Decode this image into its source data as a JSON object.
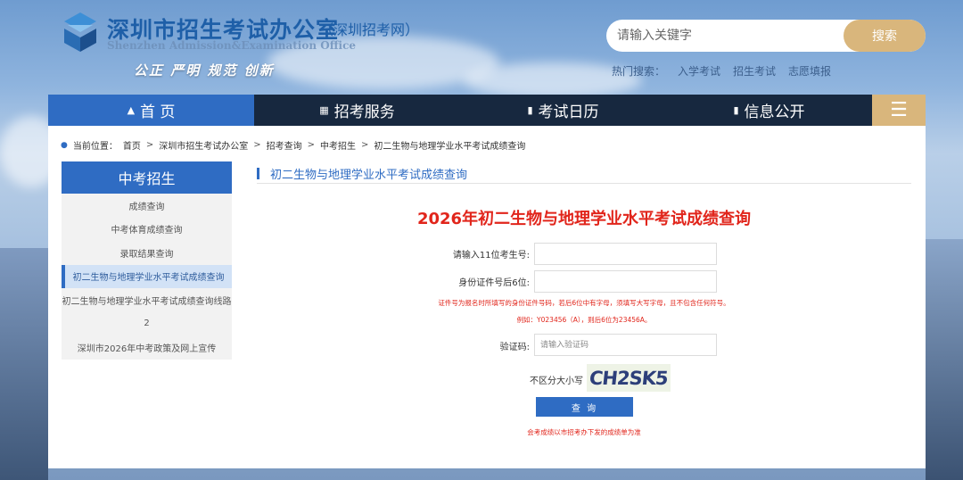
{
  "header": {
    "title": "深圳市招生考试办公室",
    "subtitle": "（深圳招考网）",
    "title_en": "Shenzhen Admission&Examination Office",
    "slogan": "公正 严明 规范 创新"
  },
  "search": {
    "placeholder": "请输入关键字",
    "button_label": "搜索",
    "hot_label": "热门搜索：",
    "hot_links": [
      "入学考试",
      "招生考试",
      "志愿填报"
    ]
  },
  "nav": {
    "items": [
      {
        "label": "首 页",
        "icon": "home-icon"
      },
      {
        "label": "招考服务",
        "icon": "grid-icon"
      },
      {
        "label": "考试日历",
        "icon": "calendar-icon"
      },
      {
        "label": "信息公开",
        "icon": "info-icon"
      }
    ],
    "menu_icon": "hamburger-icon"
  },
  "breadcrumb": {
    "prefix": "当前位置：",
    "items": [
      "首页",
      "深圳市招生考试办公室",
      "招考查询",
      "中考招生",
      "初二生物与地理学业水平考试成绩查询"
    ]
  },
  "sidebar": {
    "heading": "中考招生",
    "items": [
      "成绩查询",
      "中考体育成绩查询",
      "录取结果查询",
      "初二生物与地理学业水平考试成绩查询",
      "初二生物与地理学业水平考试成绩查询线路",
      "2",
      "深圳市2026年中考政策及网上宣传"
    ],
    "active_index": 3
  },
  "section_title": "初二生物与地理学业水平考试成绩查询",
  "form": {
    "title": "2026年初二生物与地理学业水平考试成绩查询",
    "exam_no_label": "请输入11位考生号:",
    "id_label": "身份证件号后6位:",
    "id_note": "证件号为报名时所填写的身份证件号码，若后6位中有字母，须填写大写字母，且不包含任何符号。",
    "id_example": "例如：Y023456（A），则后6位为23456A。",
    "captcha_label": "验证码:",
    "captcha_placeholder": "请输入验证码",
    "case_note": "不区分大小写",
    "captcha_text": "CH2SK5",
    "submit_label": "查 询",
    "footer_note": "会考成绩以市招考办下发的成绩单为准"
  },
  "colors": {
    "nav_bg": "#17283f",
    "nav_active": "#2f6cc3",
    "gold": "#d9b67c",
    "red": "#e1251b"
  }
}
